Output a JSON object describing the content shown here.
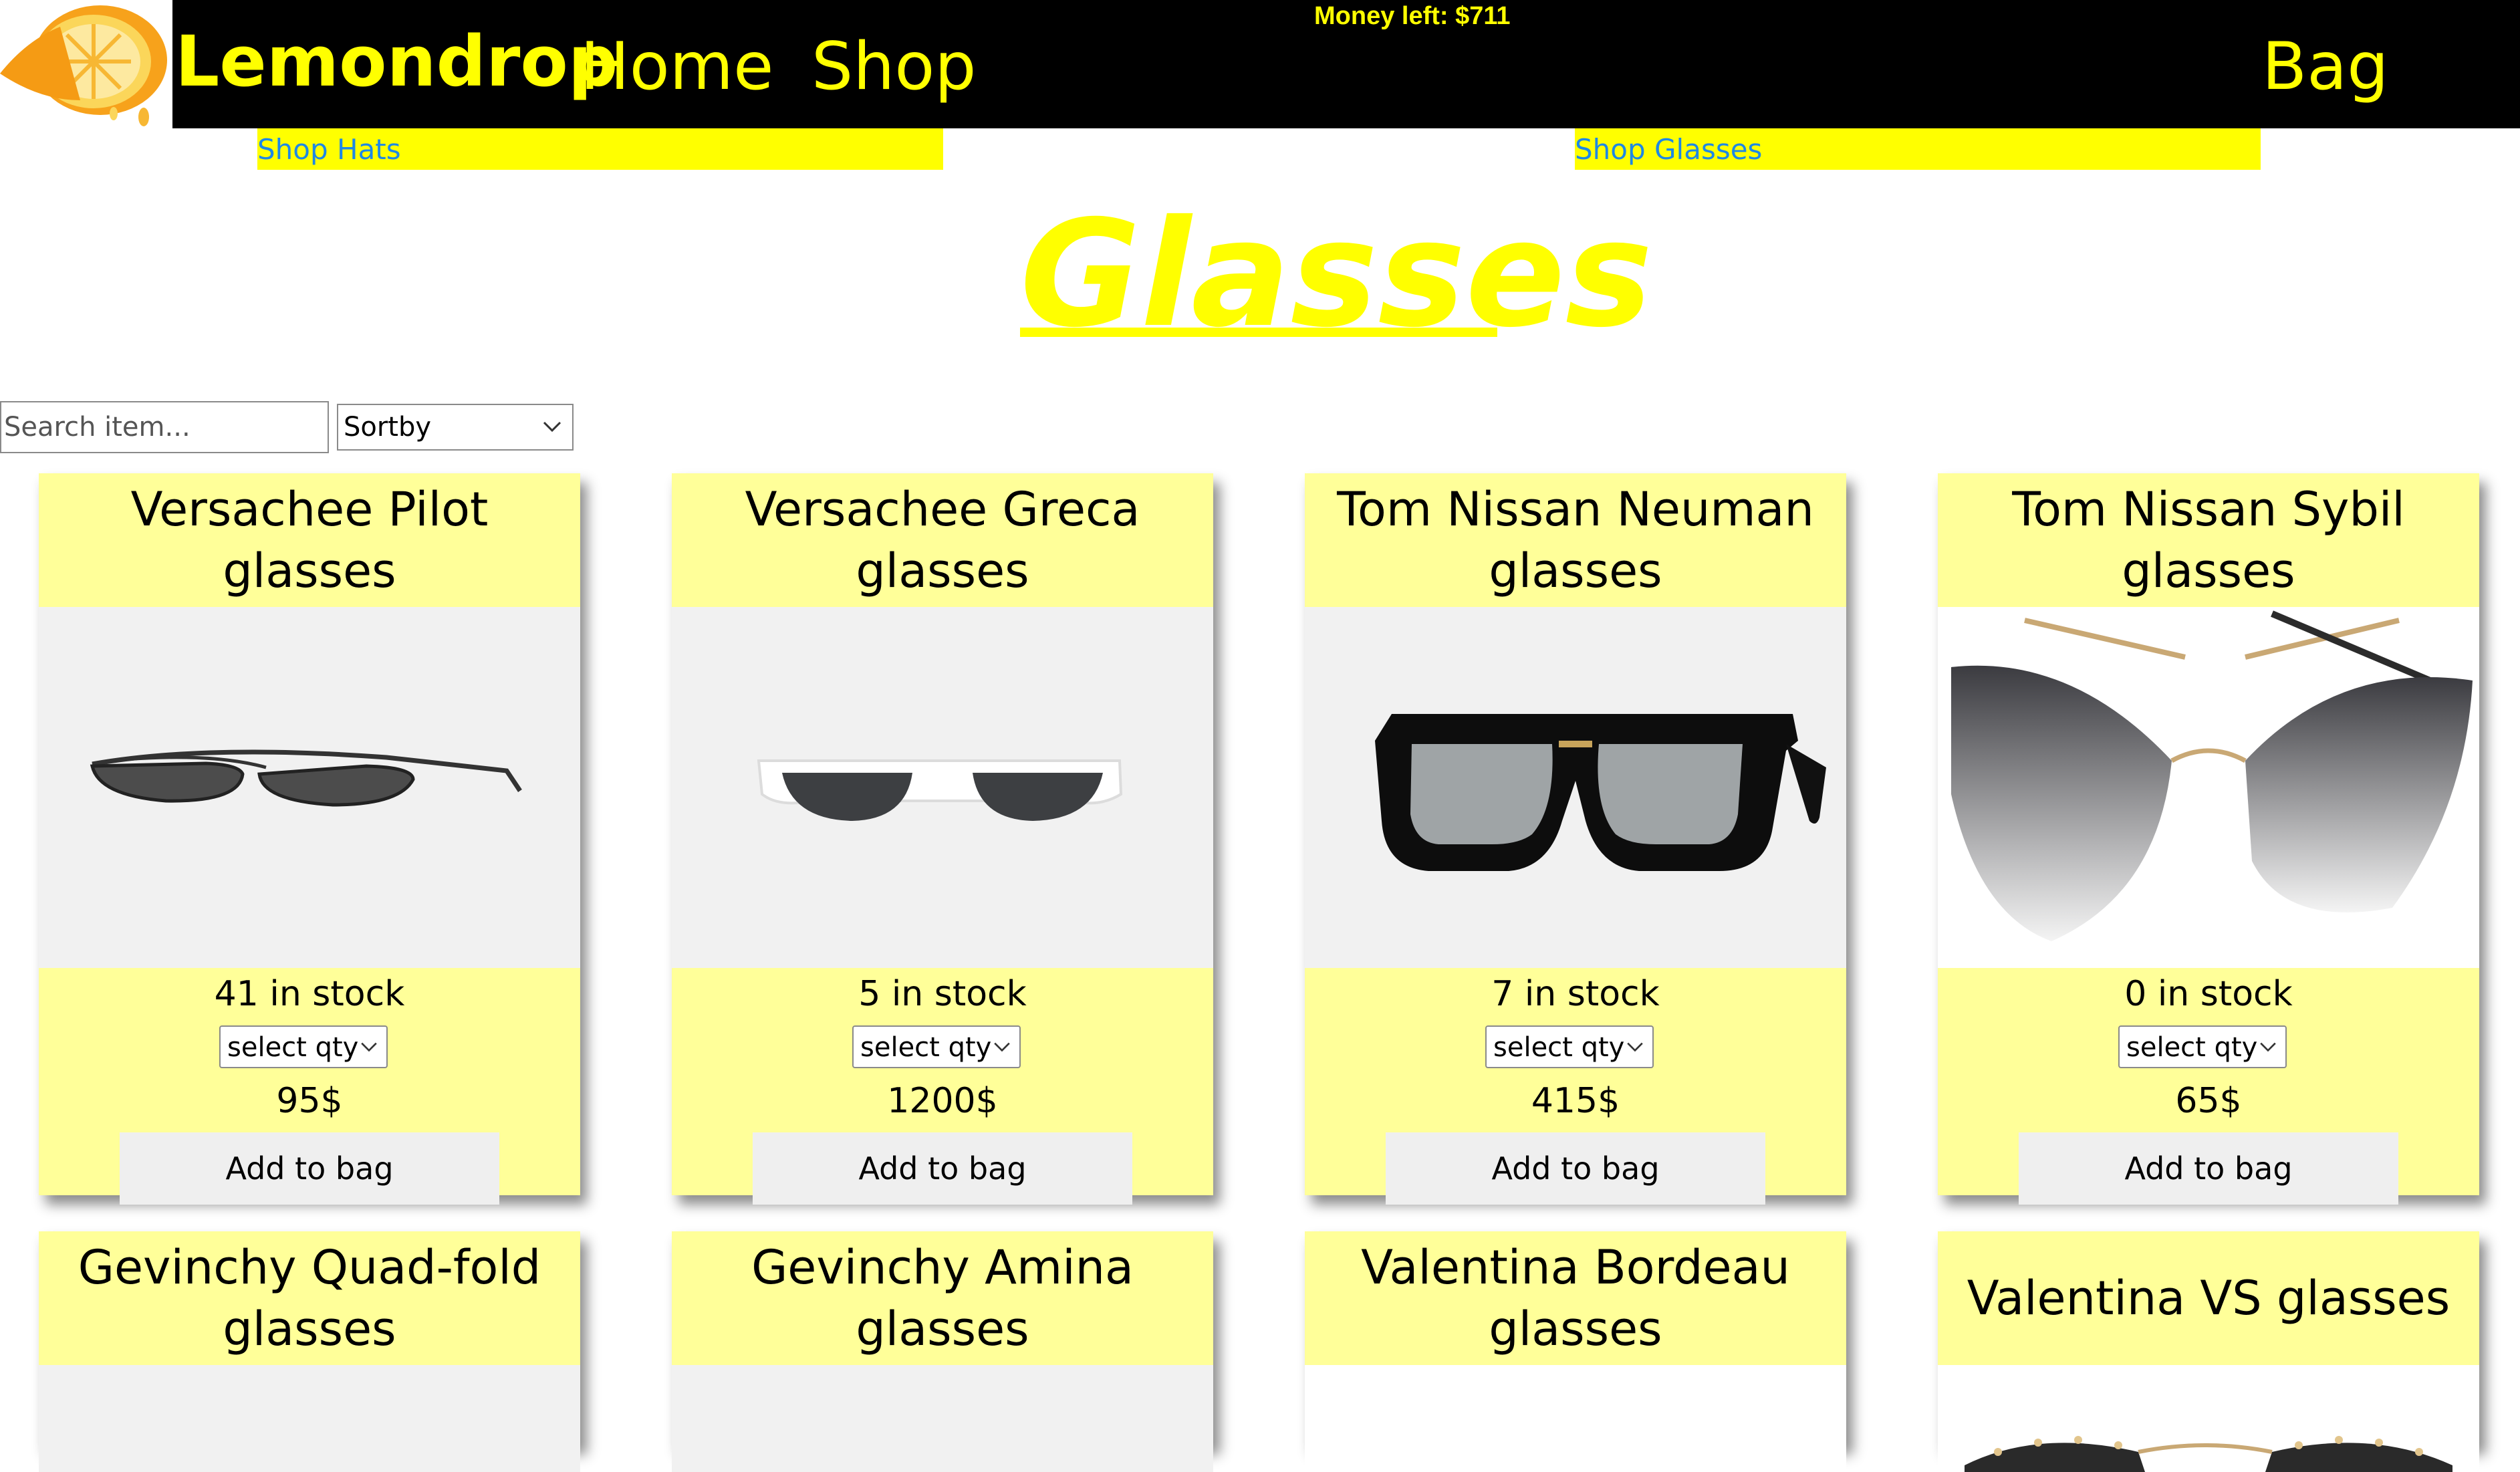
{
  "header": {
    "brand": "Lemondrop",
    "nav": {
      "home": "Home",
      "shop": "Shop",
      "bag": "Bag"
    },
    "money_left": "Money left: $711",
    "colors": {
      "bar": "#000000",
      "accent": "#ffff00"
    },
    "logo_icon": "lemon-slice-icon"
  },
  "subnav": {
    "hats": "Shop Hats",
    "glasses": "Shop Glasses"
  },
  "page": {
    "title": "Glasses"
  },
  "filters": {
    "search_placeholder": "Search item...",
    "sort_label": "Sortby"
  },
  "products": [
    {
      "name": "Versachee Pilot glasses",
      "stock": "41 in stock",
      "qty_label": "select qty",
      "price": "95$",
      "add_label": "Add to bag",
      "image_icon": "aviator-sunglasses-icon"
    },
    {
      "name": "Versachee Greca glasses",
      "stock": "5 in stock",
      "qty_label": "select qty",
      "price": "1200$",
      "add_label": "Add to bag",
      "image_icon": "white-frame-sunglasses-icon"
    },
    {
      "name": "Tom Nissan Neuman glasses",
      "stock": "7 in stock",
      "qty_label": "select qty",
      "price": "415$",
      "add_label": "Add to bag",
      "image_icon": "square-black-sunglasses-icon"
    },
    {
      "name": "Tom Nissan Sybil glasses",
      "stock": "0 in stock",
      "qty_label": "select qty",
      "price": "65$",
      "add_label": "Add to bag",
      "image_icon": "cat-eye-gradient-sunglasses-icon"
    },
    {
      "name": "Gevinchy Quad-fold glasses"
    },
    {
      "name": "Gevinchy Amina glasses"
    },
    {
      "name": "Valentina Bordeau glasses"
    },
    {
      "name": "Valentina VS glasses",
      "image_icon": "studded-sunglasses-icon"
    }
  ]
}
